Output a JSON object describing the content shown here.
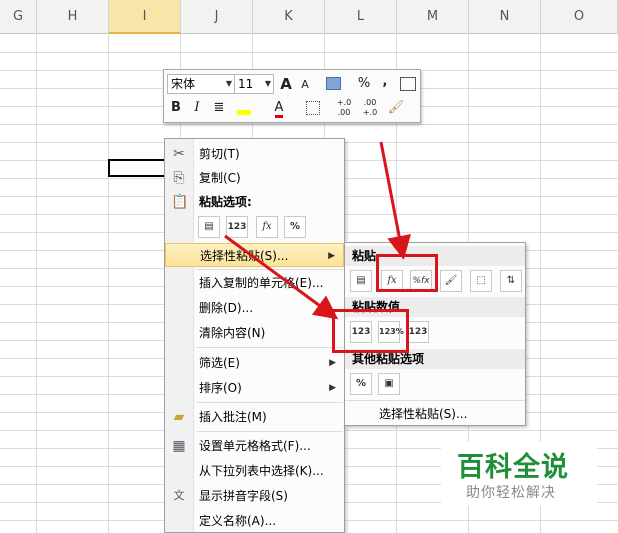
{
  "columns": [
    "G",
    "H",
    "I",
    "J",
    "K",
    "L",
    "M",
    "N",
    "O"
  ],
  "selected_column": "I",
  "mini_toolbar": {
    "font_name": "宋体",
    "font_size": "11",
    "grow_font": "A",
    "shrink_font": "A",
    "percent": "%",
    "comma": ",",
    "bold": "B",
    "italic": "I",
    "font_color": "A",
    "inc_decimal": "+.0 .00",
    "dec_decimal": ".00 +.0"
  },
  "context_menu": {
    "cut": "剪切(T)",
    "copy": "复制(C)",
    "paste_options_header": "粘贴选项:",
    "paste_option_icons": [
      "paste",
      "123",
      "fx",
      "%"
    ],
    "paste_special": "选择性粘贴(S)...",
    "insert_copied_cells": "插入复制的单元格(E)...",
    "delete": "删除(D)...",
    "clear_contents": "清除内容(N)",
    "filter": "筛选(E)",
    "sort": "排序(O)",
    "insert_comment": "插入批注(M)",
    "format_cells": "设置单元格格式(F)...",
    "pick_from_list": "从下拉列表中选择(K)...",
    "show_phonetic": "显示拼音字段(S)",
    "define_name": "定义名称(A)..."
  },
  "submenu": {
    "paste_header": "粘贴",
    "paste_icons": [
      "paste",
      "fx",
      "%fx",
      "format",
      "borders",
      "transpose"
    ],
    "paste_values_header": "粘贴数值",
    "paste_values_icons": [
      "123",
      "123%",
      "123fmt"
    ],
    "other_header": "其他粘贴选项",
    "other_icons": [
      "%link",
      "picture"
    ],
    "paste_special": "选择性粘贴(S)..."
  },
  "watermark": {
    "title": "百科全说",
    "subtitle": "助你轻松解决"
  },
  "colors": {
    "arrow_red": "#d8151b",
    "highlight": "#fbe39a",
    "watermark_green": "#1f8f38"
  }
}
